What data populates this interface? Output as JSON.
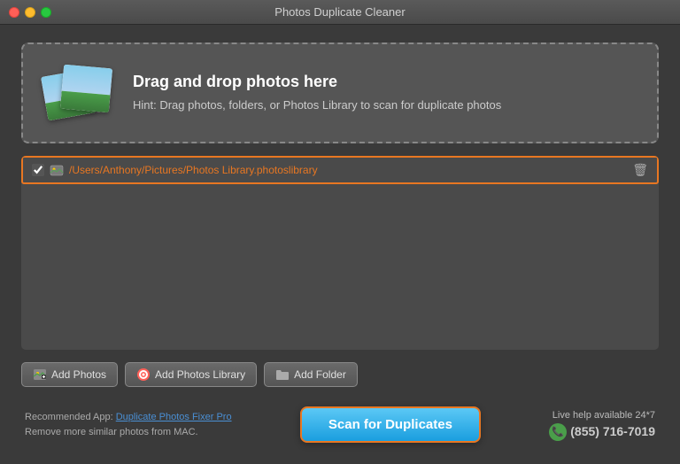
{
  "window": {
    "title": "Photos Duplicate Cleaner"
  },
  "traffic_lights": {
    "close": "close",
    "minimize": "minimize",
    "maximize": "maximize"
  },
  "drop_zone": {
    "heading": "Drag and drop photos here",
    "hint": "Hint: Drag photos, folders, or Photos Library to scan for duplicate photos"
  },
  "file_list": [
    {
      "path": "/Users/Anthony/Pictures/Photos Library.photoslibrary",
      "checked": true
    }
  ],
  "toolbar": {
    "add_photos_label": "Add Photos",
    "add_photos_library_label": "Add Photos Library",
    "add_folder_label": "Add Folder"
  },
  "bottom": {
    "recommended_label": "Recommended App:",
    "recommended_app_name": "Duplicate Photos Fixer Pro",
    "recommended_desc": "Remove more similar photos from MAC.",
    "scan_button_label": "Scan for Duplicates",
    "live_help_label": "Live help available 24*7",
    "phone_number": "(855) 716-7019"
  }
}
